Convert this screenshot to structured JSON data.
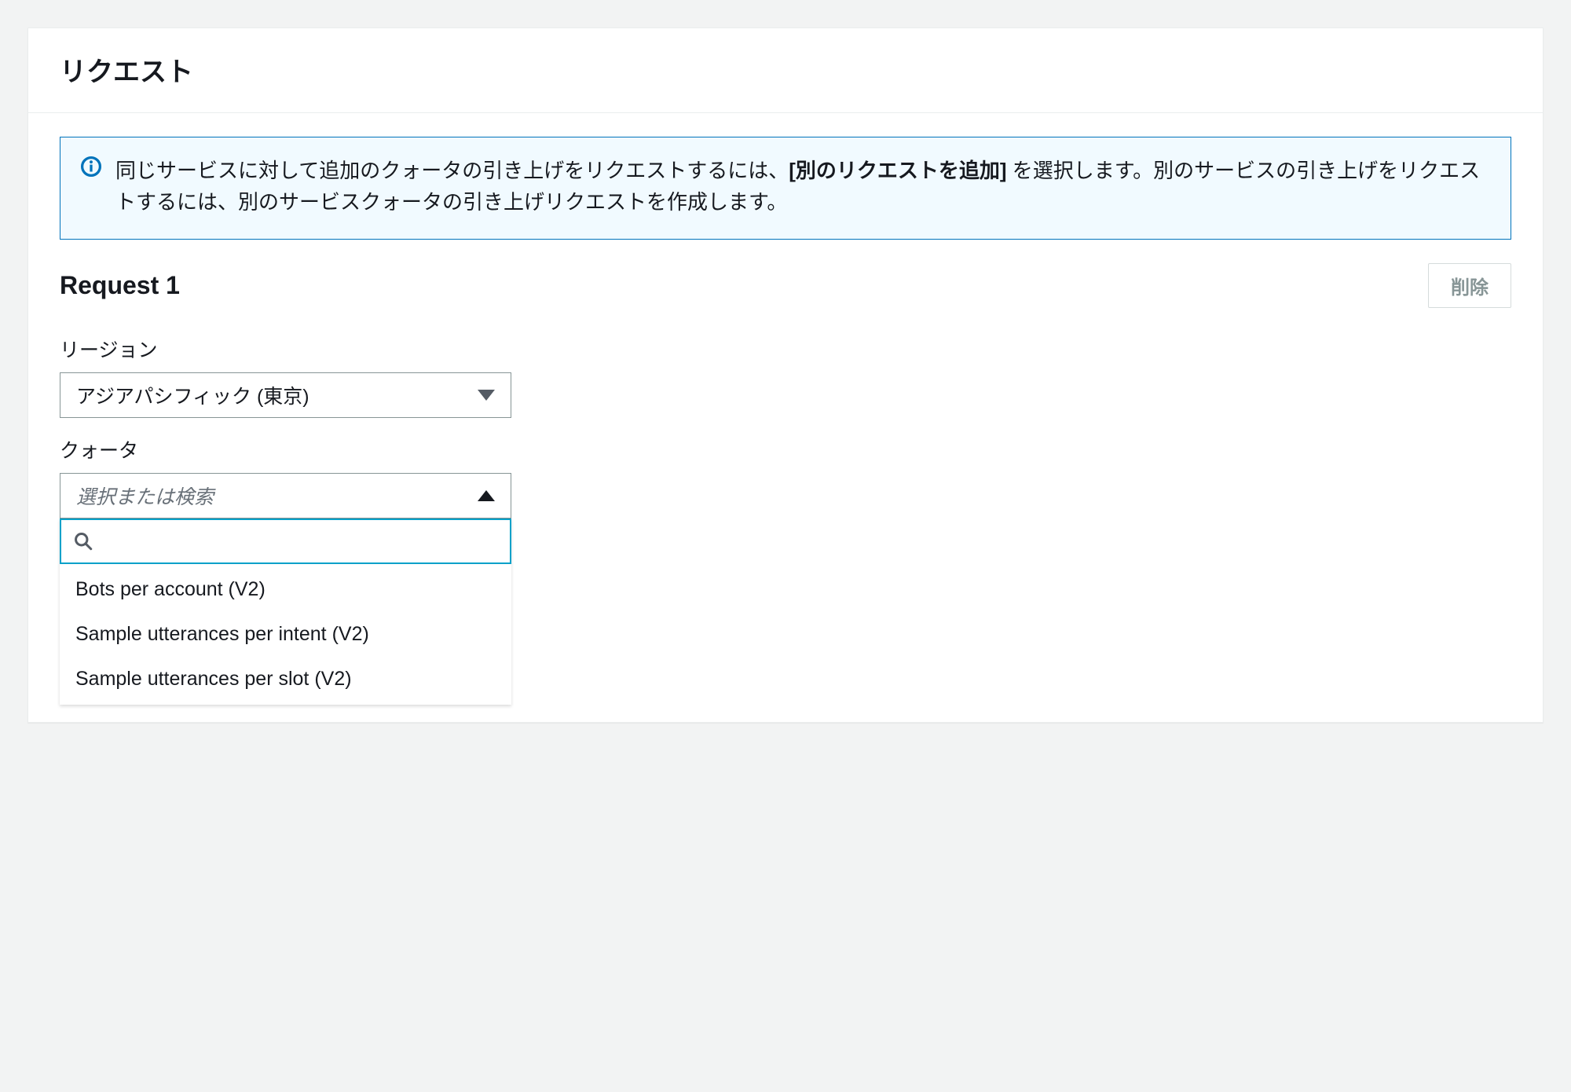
{
  "panel": {
    "title": "リクエスト"
  },
  "info": {
    "text_before_bold": "同じサービスに対して追加のクォータの引き上げをリクエストするには、",
    "bold": "[別のリクエストを追加]",
    "text_after_bold": " を選択します。別のサービスの引き上げをリクエストするには、別のサービスクォータの引き上げリクエストを作成します。"
  },
  "request": {
    "heading": "Request 1",
    "delete_label": "削除",
    "region": {
      "label": "リージョン",
      "value": "アジアパシフィック (東京)"
    },
    "quota": {
      "label": "クォータ",
      "placeholder": "選択または検索",
      "options": [
        "Bots per account (V2)",
        "Sample utterances per intent (V2)",
        "Sample utterances per slot (V2)"
      ]
    }
  }
}
